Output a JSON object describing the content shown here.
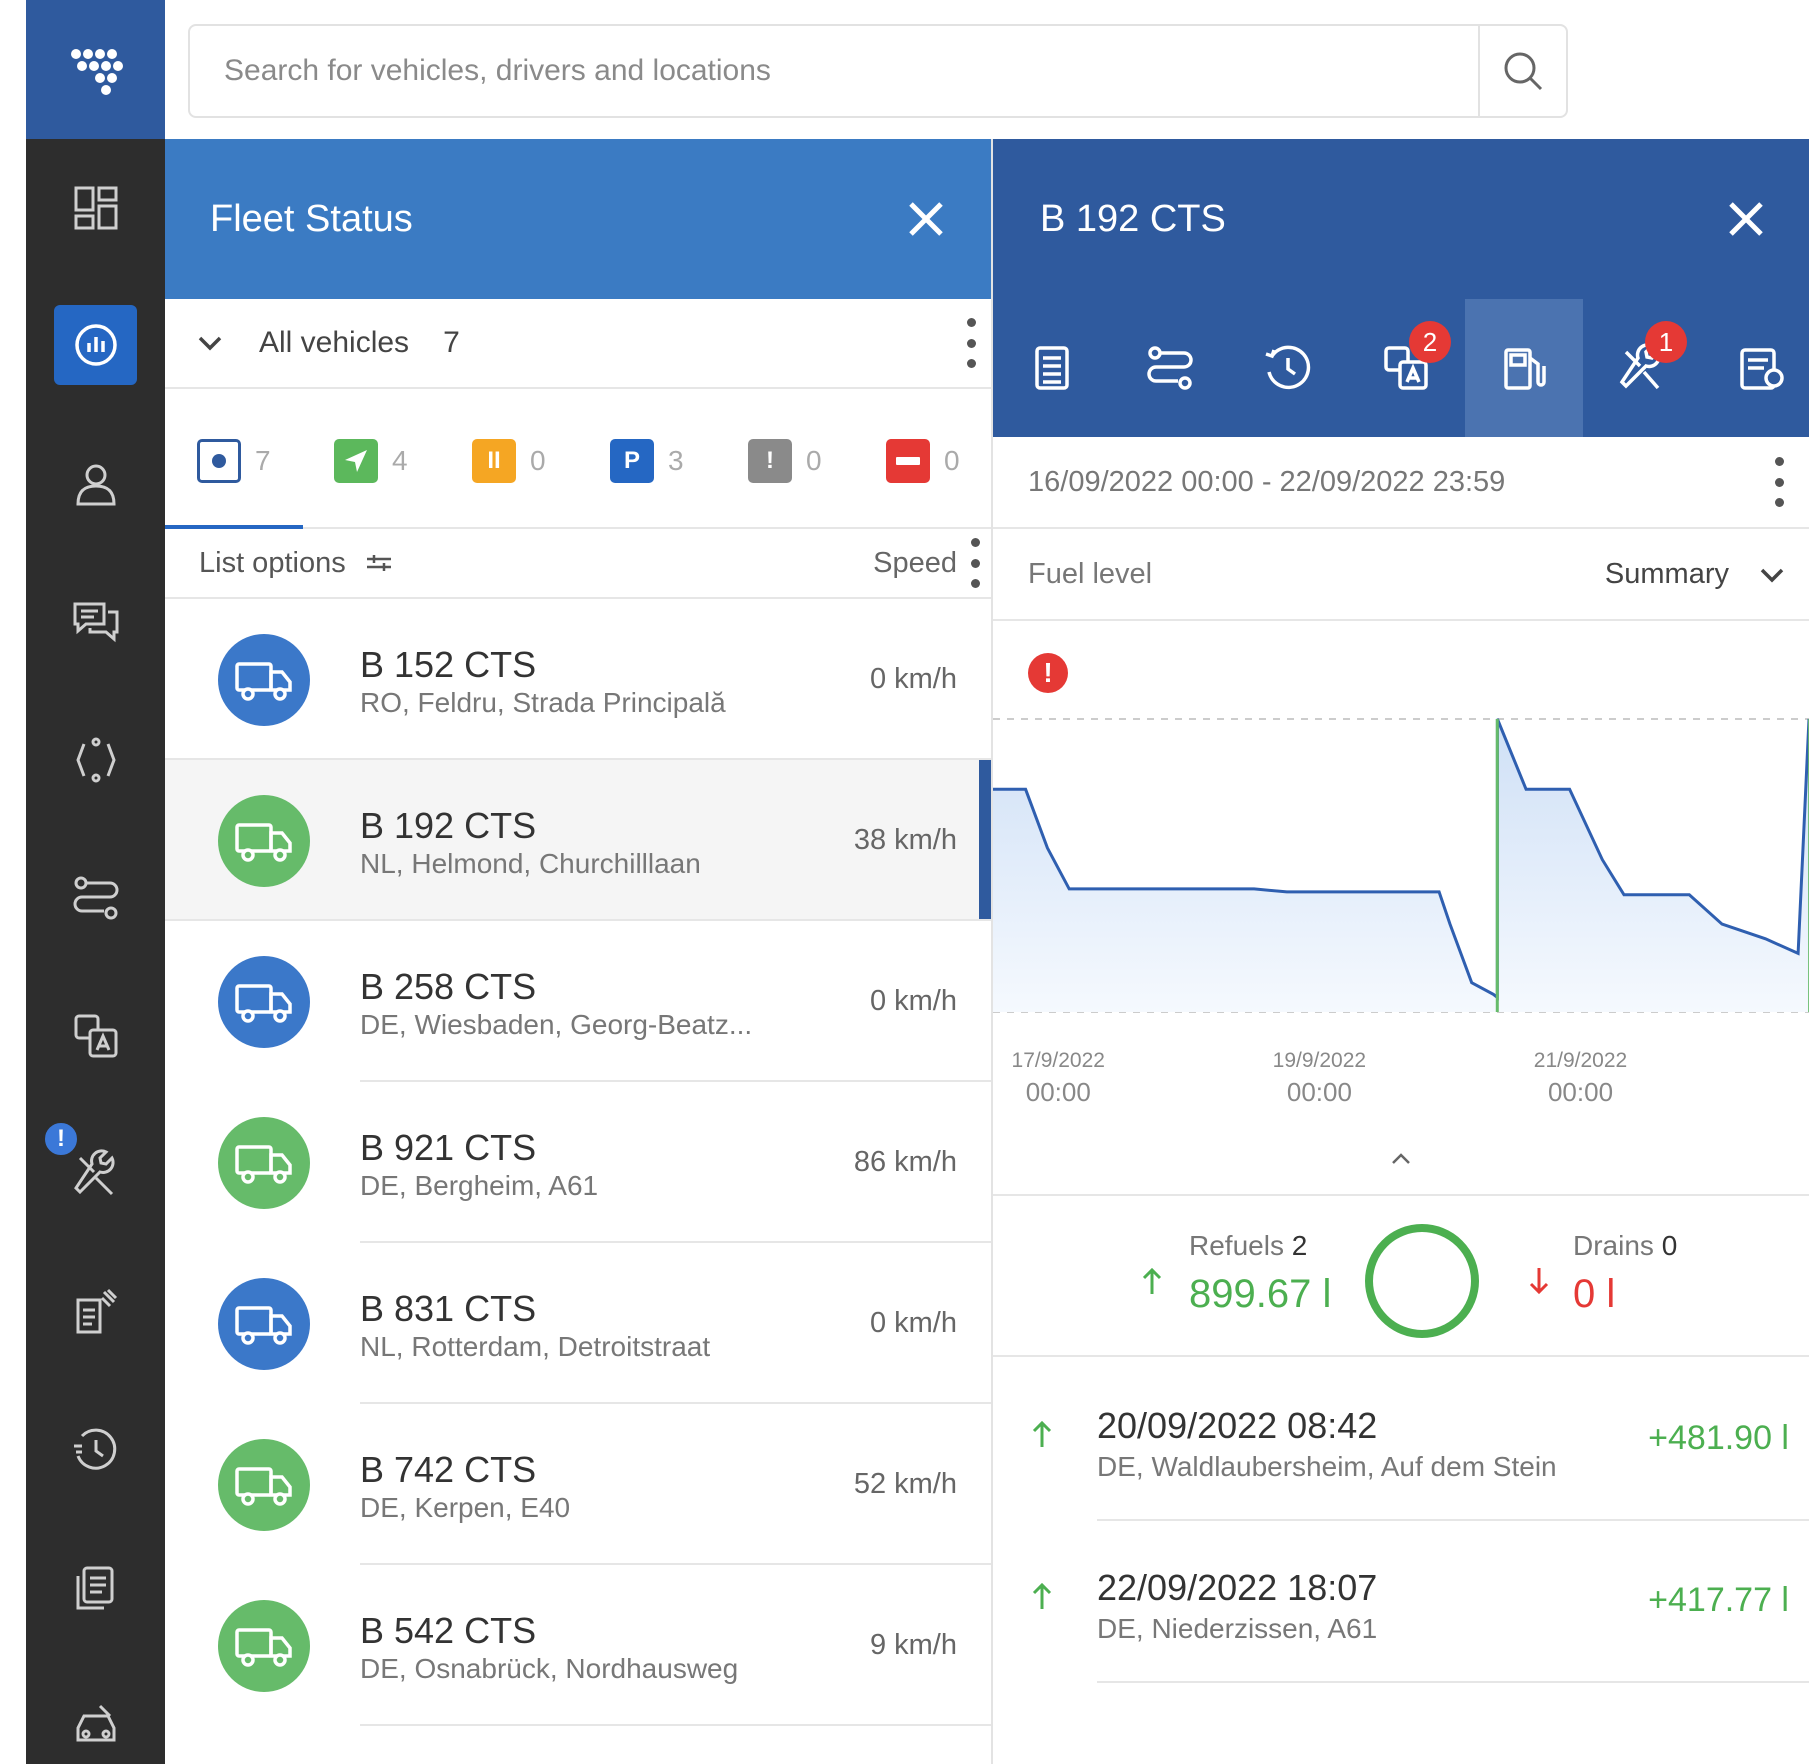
{
  "search": {
    "placeholder": "Search for vehicles, drivers and locations"
  },
  "sidebar": {
    "items": [
      {
        "icon": "dashboard-icon"
      },
      {
        "icon": "fleet-status-icon",
        "active": true
      },
      {
        "icon": "driver-icon"
      },
      {
        "icon": "messages-icon"
      },
      {
        "icon": "sync-icon"
      },
      {
        "icon": "routes-icon"
      },
      {
        "icon": "translate-icon"
      },
      {
        "icon": "maintenance-icon",
        "badge": "!"
      },
      {
        "icon": "reports-icon"
      },
      {
        "icon": "history-icon"
      },
      {
        "icon": "documents-icon"
      },
      {
        "icon": "vehicle-icon"
      }
    ]
  },
  "fleet": {
    "title": "Fleet Status",
    "group_label": "All vehicles",
    "group_count": "7",
    "filters": [
      {
        "name": "all",
        "count": "7",
        "color": "#2f5a9e",
        "glyph": ""
      },
      {
        "name": "driving",
        "count": "4",
        "color": "#5cb85c",
        "glyph": ""
      },
      {
        "name": "paused",
        "count": "0",
        "color": "#f5a623",
        "glyph": "II"
      },
      {
        "name": "parked",
        "count": "3",
        "color": "#2567c3",
        "glyph": "P"
      },
      {
        "name": "alert",
        "count": "0",
        "color": "#8a8a8a",
        "glyph": "!"
      },
      {
        "name": "blocked",
        "count": "0",
        "color": "#e53935",
        "glyph": ""
      }
    ],
    "list_options_label": "List options",
    "sort_label": "Speed",
    "vehicles": [
      {
        "plate": "B 152 CTS",
        "location": "RO, Feldru, Strada Principală",
        "speed": "0 km/h",
        "status_color": "#3b78c9"
      },
      {
        "plate": "B 192 CTS",
        "location": "NL, Helmond, Churchilllaan",
        "speed": "38 km/h",
        "status_color": "#66bb6a",
        "selected": true
      },
      {
        "plate": "B 258 CTS",
        "location": "DE, Wiesbaden, Georg-Beatz...",
        "speed": "0 km/h",
        "status_color": "#3b78c9"
      },
      {
        "plate": "B 921 CTS",
        "location": "DE, Bergheim, A61",
        "speed": "86 km/h",
        "status_color": "#66bb6a"
      },
      {
        "plate": "B 831 CTS",
        "location": "NL, Rotterdam, Detroitstraat",
        "speed": "0 km/h",
        "status_color": "#3b78c9"
      },
      {
        "plate": "B 742 CTS",
        "location": "DE, Kerpen, E40",
        "speed": "52 km/h",
        "status_color": "#66bb6a"
      },
      {
        "plate": "B 542 CTS",
        "location": "DE, Osnabrück, Nordhausweg",
        "speed": "9 km/h",
        "status_color": "#66bb6a"
      }
    ]
  },
  "detail": {
    "title": "B 192 CTS",
    "tools": [
      {
        "icon": "trip-log-icon"
      },
      {
        "icon": "route-icon"
      },
      {
        "icon": "history-icon"
      },
      {
        "icon": "translate-icon",
        "badge": "2"
      },
      {
        "icon": "fuel-pump-icon",
        "active": true
      },
      {
        "icon": "maintenance-icon",
        "badge": "1"
      },
      {
        "icon": "report-icon"
      }
    ],
    "date_range": "16/09/2022 00:00 - 22/09/2022 23:59",
    "metric_label": "Fuel level",
    "view_label": "Summary",
    "warning_glyph": "!",
    "refuels_label": "Refuels",
    "refuels_count": "2",
    "refuels_total": "899.67 l",
    "drains_label": "Drains",
    "drains_count": "0",
    "drains_total": "0 l",
    "events": [
      {
        "time": "20/09/2022 08:42",
        "location": "DE, Waldlaubersheim, Auf dem Stein",
        "amount": "+481.90 l"
      },
      {
        "time": "22/09/2022 18:07",
        "location": "DE, Niederzissen, A61",
        "amount": "+417.77 l"
      }
    ]
  },
  "chart_data": {
    "type": "area",
    "title": "Fuel level",
    "x_tick_labels": [
      {
        "date": "17/9/2022",
        "time": "00:00"
      },
      {
        "date": "19/9/2022",
        "time": "00:00"
      },
      {
        "date": "21/9/2022",
        "time": "00:00"
      }
    ],
    "x_tick_values": [
      "2022-09-17 00:00",
      "2022-09-19 00:00",
      "2022-09-21 00:00"
    ],
    "xlim": [
      "2022-09-16 12:00",
      "2022-09-22 18:00"
    ],
    "ylim": [
      0,
      1
    ],
    "y_unit": "relative level (no axis labels shown)",
    "series": [
      {
        "color": "#2f5fb0",
        "points": [
          [
            "2022-09-16 12:00",
            0.76
          ],
          [
            "2022-09-16 18:00",
            0.76
          ],
          [
            "2022-09-16 22:00",
            0.56
          ],
          [
            "2022-09-17 02:00",
            0.42
          ],
          [
            "2022-09-17 04:00",
            0.42
          ],
          [
            "2022-09-18 12:00",
            0.42
          ],
          [
            "2022-09-18 18:00",
            0.41
          ],
          [
            "2022-09-19 22:00",
            0.41
          ],
          [
            "2022-09-20 00:00",
            0.3
          ],
          [
            "2022-09-20 04:00",
            0.1
          ],
          [
            "2022-09-20 08:00",
            0.06
          ],
          [
            "2022-09-20 08:42",
            0.05
          ],
          [
            "2022-09-20 08:43",
            1.0
          ],
          [
            "2022-09-20 14:00",
            0.76
          ],
          [
            "2022-09-20 22:00",
            0.76
          ],
          [
            "2022-09-21 04:00",
            0.52
          ],
          [
            "2022-09-21 08:00",
            0.4
          ],
          [
            "2022-09-21 14:00",
            0.4
          ],
          [
            "2022-09-21 20:00",
            0.4
          ],
          [
            "2022-09-22 02:00",
            0.3
          ],
          [
            "2022-09-22 10:00",
            0.25
          ],
          [
            "2022-09-22 16:00",
            0.2
          ],
          [
            "2022-09-22 18:00",
            1.0
          ]
        ]
      }
    ],
    "refuel_markers": [
      "2022-09-20 08:42",
      "2022-09-22 18:07"
    ],
    "grid": false
  }
}
